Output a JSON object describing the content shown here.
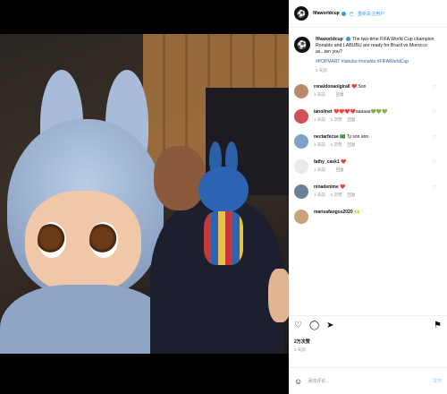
{
  "post": {
    "username": "fifaworldcup",
    "follow_label": "已 · 重新关注用户",
    "caption_author": "fifaworldcup",
    "caption_text": "The two-time FIFA World Cup champion Ronaldo and LABUBU are ready for Brazil vs Morocco as...ten you?",
    "hashtags": "#POPMART #labubu #ronaldo #FIFAWorldCup",
    "time": "1 天前"
  },
  "comments": [
    {
      "user": "ronaldonaolgirall",
      "text": "❤️ Son",
      "time": "1 天前",
      "likes": "",
      "reply": "回复",
      "color": "#b98b6d"
    },
    {
      "user": "ianolinet",
      "text": "❤️❤️❤️❤️aaaaaa💚💚💚",
      "time": "1 天前",
      "likes": "1 次赞",
      "reply": "回复",
      "color": "#d05252"
    },
    {
      "user": "nectarfecse",
      "text": "🇧🇷 Ty son ann",
      "time": "1 天前",
      "likes": "1 次赞",
      "reply": "回复",
      "color": "#7da2c6"
    },
    {
      "user": "fathy_cask1",
      "text": "❤️",
      "time": "1 天前",
      "likes": "",
      "reply": "回复",
      "color": "#e9e9e9"
    },
    {
      "user": "ninadenime",
      "text": "❤️",
      "time": "1 天前",
      "likes": "1 次赞",
      "reply": "回复",
      "color": "#6b7f96"
    },
    {
      "user": "marisafangos2020",
      "text": "🙌",
      "time": "",
      "likes": "",
      "reply": "",
      "color": "#c9a27b"
    }
  ],
  "actions": {
    "like_icon": "heart-icon",
    "comment_icon": "comment-icon",
    "share_icon": "send-icon",
    "save_icon": "bookmark-icon"
  },
  "likes_count": "2万次赞",
  "post_date": "1 天前",
  "add_comment_placeholder": "添加评论...",
  "post_button": "发布",
  "colors": {
    "link": "#2d5fa4",
    "verified": "#3897f0"
  }
}
